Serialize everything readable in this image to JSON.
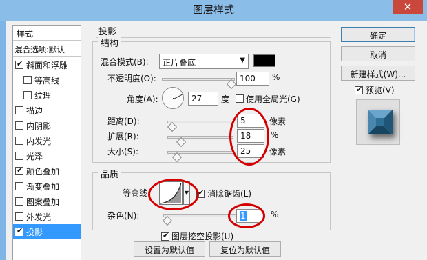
{
  "window": {
    "title": "图层样式",
    "close_glyph": "✕"
  },
  "style_list": {
    "header": "样式",
    "blend_options": "混合选项:默认",
    "items": [
      {
        "label": "斜面和浮雕",
        "checked": true,
        "indent": false,
        "selected": false
      },
      {
        "label": "等高线",
        "checked": false,
        "indent": true,
        "selected": false
      },
      {
        "label": "纹理",
        "checked": false,
        "indent": true,
        "selected": false
      },
      {
        "label": "描边",
        "checked": false,
        "indent": false,
        "selected": false
      },
      {
        "label": "内阴影",
        "checked": false,
        "indent": false,
        "selected": false
      },
      {
        "label": "内发光",
        "checked": false,
        "indent": false,
        "selected": false
      },
      {
        "label": "光泽",
        "checked": false,
        "indent": false,
        "selected": false
      },
      {
        "label": "颜色叠加",
        "checked": true,
        "indent": false,
        "selected": false
      },
      {
        "label": "渐变叠加",
        "checked": false,
        "indent": false,
        "selected": false
      },
      {
        "label": "图案叠加",
        "checked": false,
        "indent": false,
        "selected": false
      },
      {
        "label": "外发光",
        "checked": false,
        "indent": false,
        "selected": false
      },
      {
        "label": "投影",
        "checked": true,
        "indent": false,
        "selected": true
      }
    ]
  },
  "drop_shadow": {
    "title": "投影",
    "structure": {
      "title": "结构",
      "blend_mode_label": "混合模式(B):",
      "blend_mode_value": "正片叠底",
      "shadow_color": "#000000",
      "opacity_label": "不透明度(O):",
      "opacity_value": "100",
      "opacity_fraction": 1.0,
      "percent": "%",
      "angle_label": "角度(A):",
      "angle_value": "27",
      "angle_unit": "度",
      "global_light_label": "使用全局光(G)",
      "global_light_checked": false,
      "distance_label": "距离(D):",
      "distance_value": "5",
      "distance_unit": "像素",
      "distance_fraction": 0.02,
      "spread_label": "扩展(R):",
      "spread_value": "18",
      "spread_unit": "%",
      "spread_fraction": 0.18,
      "size_label": "大小(S):",
      "size_value": "25",
      "size_unit": "像素",
      "size_fraction": 0.1
    },
    "quality": {
      "title": "品质",
      "contour_label": "等高线:",
      "anti_alias_label": "消除锯齿(L)",
      "anti_alias_checked": true,
      "noise_label": "杂色(N):",
      "noise_value": "1",
      "noise_unit": "%",
      "noise_fraction": 0.01
    },
    "knockout_label": "图层挖空投影(U)",
    "knockout_checked": true,
    "make_default": "设置为默认值",
    "reset_default": "复位为默认值"
  },
  "buttons": {
    "ok": "确定",
    "cancel": "取消",
    "new_style": "新建样式(W)...",
    "preview_label": "预览(V)",
    "preview_checked": true
  },
  "colors": {
    "annotation": "#d40000",
    "selection": "#3399ff",
    "preview_swatch": "#2e6f96"
  }
}
